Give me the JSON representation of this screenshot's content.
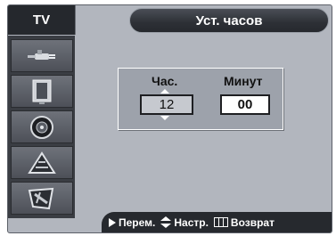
{
  "header": {
    "tab_label": "TV",
    "title": "Уст. часов"
  },
  "sidebar": {
    "items": [
      {
        "icon": "antenna-plug-icon"
      },
      {
        "icon": "picture-icon"
      },
      {
        "icon": "speaker-icon"
      },
      {
        "icon": "channel-icon"
      },
      {
        "icon": "setup-icon"
      }
    ]
  },
  "clock": {
    "hours_label": "Час.",
    "minutes_label": "Минут",
    "hours_value": "12",
    "minutes_value": "00"
  },
  "footer": {
    "move_label": "Перем.",
    "adjust_label": "Настр.",
    "return_label": "Возврат"
  },
  "colors": {
    "panel": "#b2b6be",
    "dark_bar": "#26292e",
    "sidebar": "#3a3d43"
  }
}
